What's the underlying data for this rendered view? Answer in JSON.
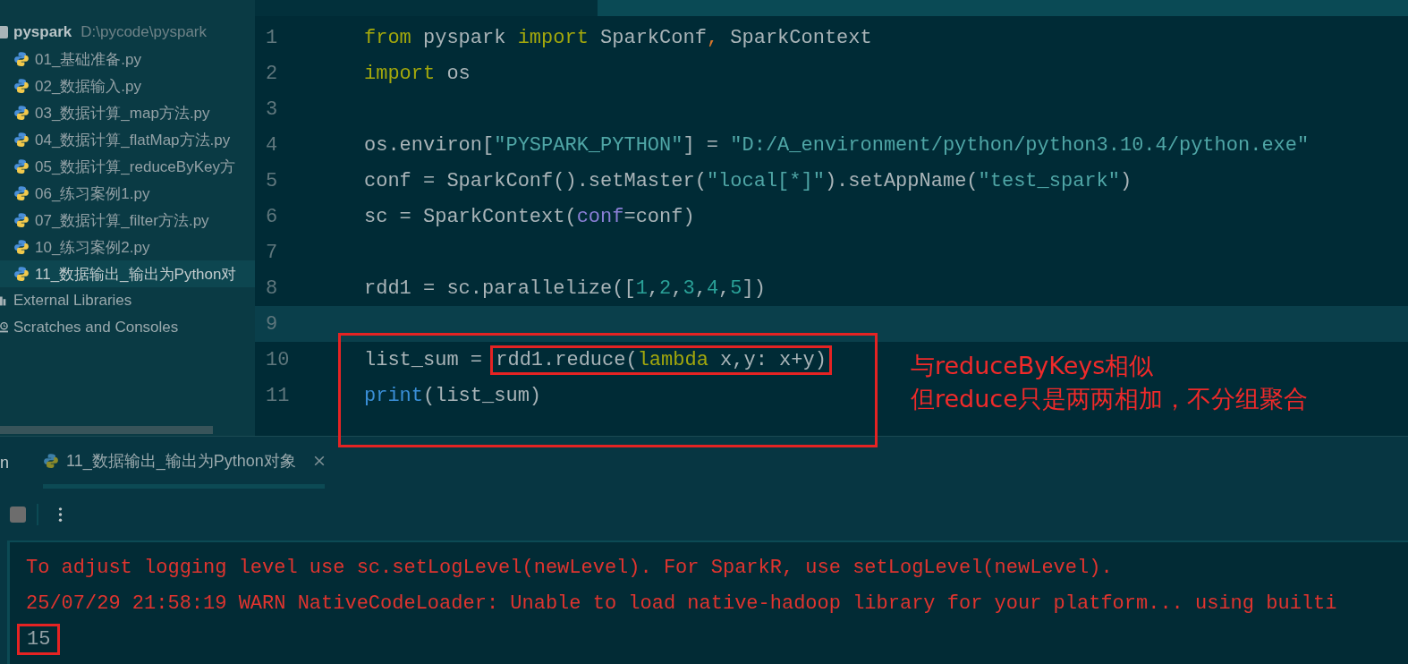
{
  "project": {
    "name": "pyspark",
    "path": "D:\\pycode\\pyspark",
    "files": [
      {
        "name": "01_基础准备.py",
        "selected": false
      },
      {
        "name": "02_数据输入.py",
        "selected": false
      },
      {
        "name": "03_数据计算_map方法.py",
        "selected": false
      },
      {
        "name": "04_数据计算_flatMap方法.py",
        "selected": false
      },
      {
        "name": "05_数据计算_reduceByKey方",
        "selected": false
      },
      {
        "name": "06_练习案例1.py",
        "selected": false
      },
      {
        "name": "07_数据计算_filter方法.py",
        "selected": false
      },
      {
        "name": "10_练习案例2.py",
        "selected": false
      },
      {
        "name": "11_数据输出_输出为Python对",
        "selected": true
      }
    ]
  },
  "tree_roots": [
    {
      "label": "External Libraries",
      "kind": "library"
    },
    {
      "label": "Scratches and Consoles",
      "kind": "scratches"
    }
  ],
  "editor": {
    "lines": [
      {
        "number": "1",
        "current": false,
        "tokens": [
          {
            "kind": "kw",
            "text": "from"
          },
          {
            "kind": "plain",
            "text": " pyspark "
          },
          {
            "kind": "kw",
            "text": "import"
          },
          {
            "kind": "plain",
            "text": " SparkConf"
          },
          {
            "kind": "punct",
            "text": ","
          },
          {
            "kind": "plain",
            "text": " SparkContext"
          }
        ]
      },
      {
        "number": "2",
        "current": false,
        "tokens": [
          {
            "kind": "kw",
            "text": "import"
          },
          {
            "kind": "plain",
            "text": " os"
          }
        ]
      },
      {
        "number": "3",
        "current": false
      },
      {
        "number": "4",
        "current": false,
        "tokens": [
          {
            "kind": "plain",
            "text": "os.environ["
          },
          {
            "kind": "str",
            "text": "\"PYSPARK_PYTHON\""
          },
          {
            "kind": "plain",
            "text": "] = "
          },
          {
            "kind": "str",
            "text": "\"D:/A_environment/python/python3.10.4/python.exe\""
          }
        ]
      },
      {
        "number": "5",
        "current": false,
        "tokens": [
          {
            "kind": "plain",
            "text": "conf = SparkConf().setMaster("
          },
          {
            "kind": "str",
            "text": "\"local[*]\""
          },
          {
            "kind": "plain",
            "text": ").setAppName("
          },
          {
            "kind": "str",
            "text": "\"test_spark\""
          },
          {
            "kind": "plain",
            "text": ")"
          }
        ]
      },
      {
        "number": "6",
        "current": false,
        "tokens": [
          {
            "kind": "plain",
            "text": "sc = SparkContext("
          },
          {
            "kind": "param",
            "text": "conf"
          },
          {
            "kind": "plain",
            "text": "=conf)"
          }
        ]
      },
      {
        "number": "7",
        "current": false
      },
      {
        "number": "8",
        "current": false,
        "tokens": [
          {
            "kind": "plain",
            "text": "rdd1 = sc.parallelize(["
          },
          {
            "kind": "num",
            "text": "1"
          },
          {
            "kind": "plain",
            "text": ","
          },
          {
            "kind": "num",
            "text": "2"
          },
          {
            "kind": "plain",
            "text": ","
          },
          {
            "kind": "num",
            "text": "3"
          },
          {
            "kind": "plain",
            "text": ","
          },
          {
            "kind": "num",
            "text": "4"
          },
          {
            "kind": "plain",
            "text": ","
          },
          {
            "kind": "num",
            "text": "5"
          },
          {
            "kind": "plain",
            "text": "])"
          }
        ]
      },
      {
        "number": "9",
        "current": true
      },
      {
        "number": "10",
        "current": false,
        "tokens": [
          {
            "kind": "plain",
            "text": "list_sum = "
          }
        ],
        "marked": [
          {
            "kind": "plain",
            "text": "rdd1.reduce("
          },
          {
            "kind": "kw",
            "text": "lambda"
          },
          {
            "kind": "plain",
            "text": " x,y: x+y)"
          }
        ]
      },
      {
        "number": "11",
        "current": false,
        "tokens": [
          {
            "kind": "builtin",
            "text": "print"
          },
          {
            "kind": "plain",
            "text": "(list_sum)"
          }
        ]
      }
    ]
  },
  "annotation": {
    "note_lines": [
      "与reduceByKeys相似",
      "但reduce只是两两相加，不分组聚合"
    ]
  },
  "run_panel": {
    "fragment": "n",
    "tab": {
      "label": "11_数据输出_输出为Python对象",
      "selected": true
    },
    "console": [
      {
        "kind": "stderr",
        "text": "To adjust logging level use sc.setLogLevel(newLevel). For SparkR, use setLogLevel(newLevel)."
      },
      {
        "kind": "stderr",
        "text": "25/07/29 21:58:19 WARN NativeCodeLoader: Unable to load native-hadoop library for your platform... using builti"
      },
      {
        "kind": "stdout",
        "text": "15",
        "boxed": true
      }
    ]
  }
}
